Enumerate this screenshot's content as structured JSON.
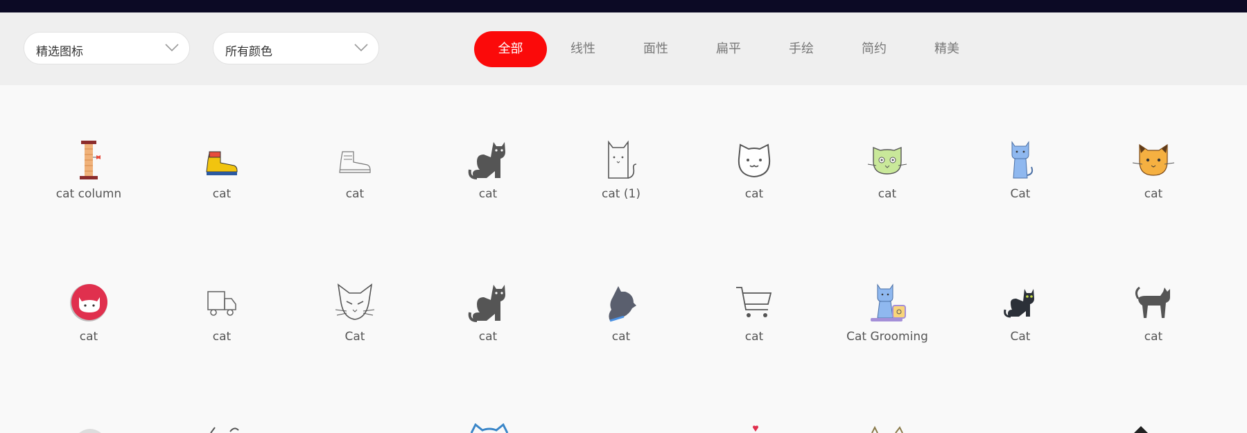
{
  "filters": {
    "icon_select": "精选图标",
    "color_select": "所有颜色"
  },
  "tabs": [
    "全部",
    "线性",
    "面性",
    "扁平",
    "手绘",
    "简约",
    "精美"
  ],
  "active_tab": "全部",
  "colors": {
    "active_tab_bg": "#fb0a0a",
    "top_bar": "#0c0a25",
    "filter_bar": "#efefef"
  },
  "rows": [
    [
      {
        "label": "cat column",
        "icon": "cat-scratching-post-icon"
      },
      {
        "label": "cat",
        "icon": "yellow-boot-icon"
      },
      {
        "label": "cat",
        "icon": "boot-outline-icon"
      },
      {
        "label": "cat",
        "icon": "cat-silhouette-icon"
      },
      {
        "label": "cat (1)",
        "icon": "cat-outline-icon"
      },
      {
        "label": "cat",
        "icon": "cat-face-outline-icon"
      },
      {
        "label": "cat",
        "icon": "green-cat-face-icon"
      },
      {
        "label": "Cat",
        "icon": "blue-sitting-cat-icon"
      },
      {
        "label": "cat",
        "icon": "orange-cat-face-icon"
      }
    ],
    [
      {
        "label": "cat",
        "icon": "red-circle-cat-icon"
      },
      {
        "label": "cat",
        "icon": "truck-outline-icon"
      },
      {
        "label": "Cat",
        "icon": "cat-mask-outline-icon"
      },
      {
        "label": "cat",
        "icon": "cat-silhouette-icon"
      },
      {
        "label": "cat",
        "icon": "cat-head-profile-icon"
      },
      {
        "label": "cat",
        "icon": "shopping-cart-icon"
      },
      {
        "label": "Cat Grooming",
        "icon": "cat-grooming-icon"
      },
      {
        "label": "Cat",
        "icon": "black-cat-icon"
      },
      {
        "label": "cat",
        "icon": "walking-cat-icon"
      }
    ]
  ]
}
